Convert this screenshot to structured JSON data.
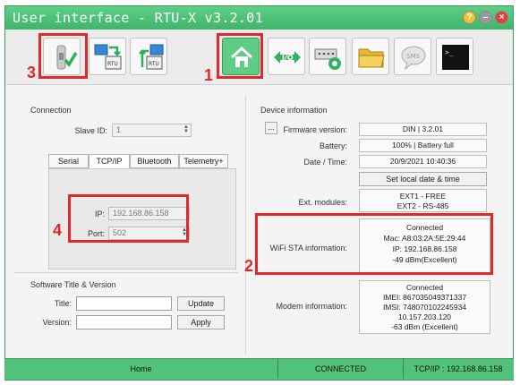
{
  "window": {
    "title": "User interface - RTU-X v3.2.01"
  },
  "toolbar": {
    "buttons": [
      {
        "icon": "connect-check-icon"
      },
      {
        "icon": "upload-to-rtu-icon"
      },
      {
        "icon": "download-from-rtu-icon"
      },
      {
        "icon": "home-icon"
      },
      {
        "icon": "io-arrows-icon"
      },
      {
        "icon": "serial-config-icon"
      },
      {
        "icon": "folder-icon"
      },
      {
        "icon": "sms-icon"
      },
      {
        "icon": "terminal-icon"
      }
    ],
    "terminal_text": ">_"
  },
  "sms_icon_text": "SMS",
  "io_icon_text": "I/O",
  "annotations": {
    "n1": "1",
    "n2": "2",
    "n3": "3",
    "n4": "4"
  },
  "connection": {
    "title": "Connection",
    "slave_label": "Slave ID:",
    "slave_value": "1",
    "tabs": [
      "Serial",
      "TCP/IP",
      "Bluetooth",
      "Telemetry+"
    ],
    "ip_label": "IP:",
    "ip_value": "192.168.86.158",
    "port_label": "Port:",
    "port_value": "502"
  },
  "software": {
    "title": "Software Title & Version",
    "title_label": "Title:",
    "version_label": "Version:",
    "update_label": "Update",
    "apply_label": "Apply"
  },
  "device": {
    "title": "Device information",
    "ellipsis": "...",
    "firmware_label": "Firmware version:",
    "firmware_value": "DIN | 3.2.01",
    "battery_label": "Battery:",
    "battery_value": "100% | Battery full",
    "datetime_label": "Date / Time:",
    "datetime_value": "20/9/2021 10:40:36",
    "set_date_label": "Set local date & time",
    "ext_label": "Ext. modules:",
    "ext_lines": [
      "EXT1 - FREE",
      "EXT2 - RS-485"
    ],
    "wifi_label": "WiFi STA information:",
    "wifi_lines": [
      "Connected",
      "Mac: A8:03:2A:5E:29:44",
      "IP: 192.168.86.158",
      "-49 dBm(Excellent)"
    ],
    "modem_label": "Modem information:",
    "modem_lines": [
      "Connected",
      "IMEI: 867035049371337",
      "IMSI: 748070102245934",
      "10.157.203.120",
      "-63 dBm (Excellent)"
    ]
  },
  "statusbar": {
    "left": "Home",
    "middle": "CONNECTED",
    "right": "TCP/IP : 192.168.86.158"
  },
  "colors": {
    "accent": "#4cbf78",
    "annotation": "#e1282c"
  }
}
